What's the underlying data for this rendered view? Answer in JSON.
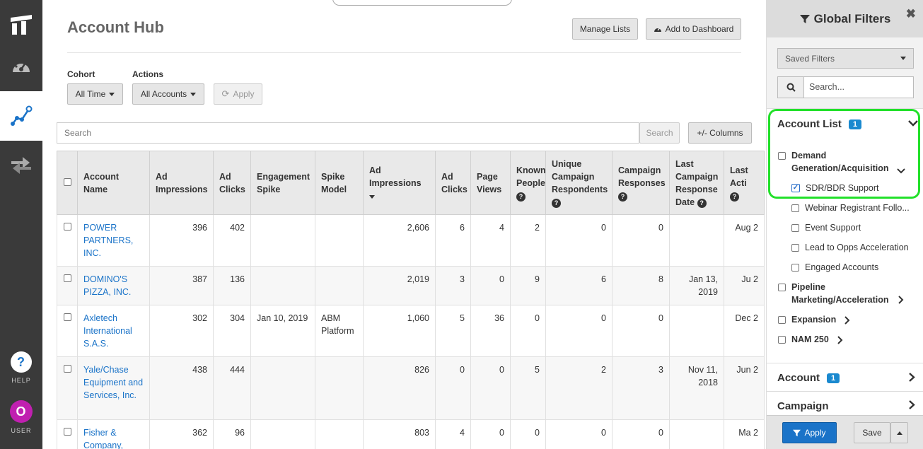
{
  "sidebar": {
    "help_label": "HELP",
    "help_glyph": "?",
    "user_label": "USER",
    "user_initial": "O",
    "user_color": "#c020b0"
  },
  "header": {
    "title": "Account Hub",
    "manage_lists": "Manage Lists",
    "add_to_dashboard": "Add to Dashboard"
  },
  "filters": {
    "cohort_label": "Cohort",
    "cohort_value": "All Time",
    "actions_label": "Actions",
    "actions_value": "All Accounts",
    "apply": "Apply"
  },
  "search": {
    "placeholder": "Search",
    "button": "Search",
    "columns_button": "+/- Columns"
  },
  "table": {
    "columns": [
      "Account Name",
      "Ad Impressions",
      "Ad Clicks",
      "Engagement Spike",
      "Spike Model",
      "Ad Impressions",
      "Ad Clicks",
      "Page Views",
      "Known People",
      "Unique Campaign Respondents",
      "Campaign Responses",
      "Last Campaign Response Date",
      "Last Acti"
    ],
    "rows": [
      {
        "name": "POWER PARTNERS, INC.",
        "c1": "396",
        "c2": "402",
        "c3": "",
        "c4": "",
        "c5": "2,606",
        "c6": "6",
        "c7": "4",
        "c8": "2",
        "c9": "0",
        "c10": "0",
        "c11": "",
        "c12": "Aug 2"
      },
      {
        "name": "DOMINO'S PIZZA, INC.",
        "c1": "387",
        "c2": "136",
        "c3": "",
        "c4": "",
        "c5": "2,019",
        "c6": "3",
        "c7": "0",
        "c8": "9",
        "c9": "6",
        "c10": "8",
        "c11": "Jan 13, 2019",
        "c12": "Ju 2"
      },
      {
        "name": "Axletech International S.A.S.",
        "c1": "302",
        "c2": "304",
        "c3": "Jan 10, 2019",
        "c4": "ABM Platform",
        "c5": "1,060",
        "c6": "5",
        "c7": "36",
        "c8": "0",
        "c9": "0",
        "c10": "0",
        "c11": "",
        "c12": "Dec 2"
      },
      {
        "name": "Yale/Chase Equipment and Services, Inc.",
        "c1": "438",
        "c2": "444",
        "c3": "",
        "c4": "",
        "c5": "826",
        "c6": "0",
        "c7": "0",
        "c8": "5",
        "c9": "2",
        "c10": "3",
        "c11": "Nov 11, 2018",
        "c12": "Jun 2"
      },
      {
        "name": "Fisher & Company,",
        "c1": "362",
        "c2": "96",
        "c3": "",
        "c4": "",
        "c5": "803",
        "c6": "4",
        "c7": "0",
        "c8": "0",
        "c9": "0",
        "c10": "0",
        "c11": "",
        "c12": "Ma 2"
      }
    ]
  },
  "panel": {
    "title": "Global Filters",
    "saved_filters": "Saved Filters",
    "search_placeholder": "Search...",
    "account_list": "Account List",
    "account_list_count": "1",
    "items": {
      "demand": "Demand Generation/Acquisition",
      "sdr": "SDR/BDR Support",
      "webinar": "Webinar Registrant Follo...",
      "event": "Event Support",
      "lead": "Lead to Opps Acceleration",
      "engaged": "Engaged Accounts",
      "pipeline": "Pipeline Marketing/Acceleration",
      "expansion": "Expansion",
      "nam": "NAM 250"
    },
    "account": "Account",
    "account_count": "1",
    "campaign": "Campaign",
    "apply": "Apply",
    "save": "Save",
    "highlight_color": "#22e02a"
  }
}
